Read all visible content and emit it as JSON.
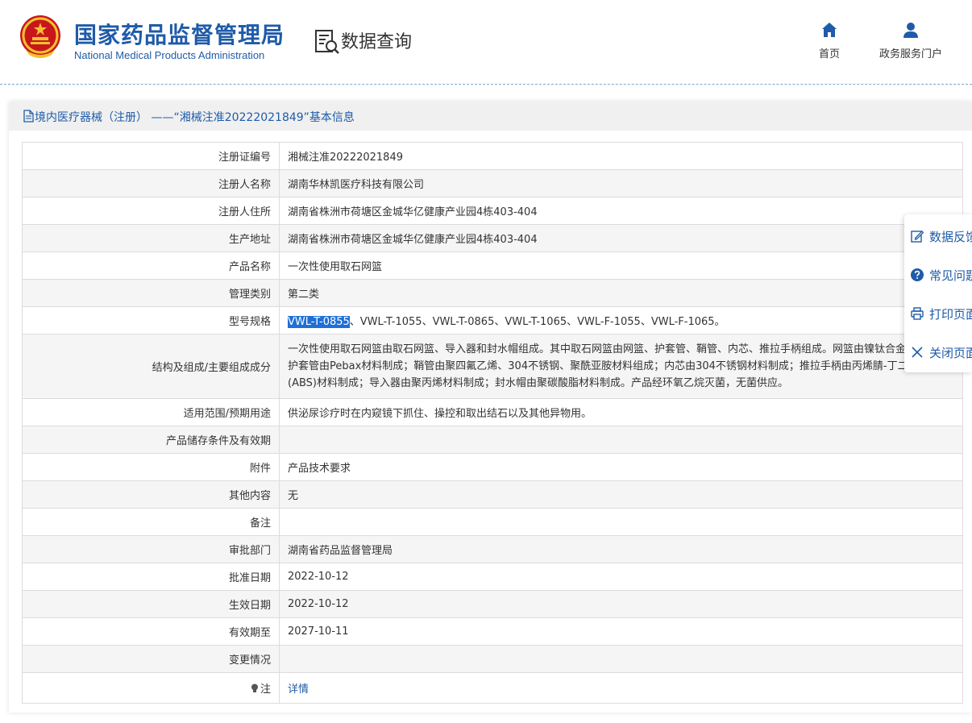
{
  "header": {
    "brand_cn": "国家药品监督管理局",
    "brand_en": "National Medical Products Administration",
    "section_title": "数据查询",
    "nav": [
      {
        "label": "首页",
        "icon": "home-icon"
      },
      {
        "label": "政务服务门户",
        "icon": "user-icon"
      }
    ]
  },
  "panel": {
    "title": "境内医疗器械（注册） ——“湘械注准20222021849”基本信息",
    "rows": [
      {
        "label": "注册证编号",
        "value": "湘械注准20222021849"
      },
      {
        "label": "注册人名称",
        "value": "湖南华林凯医疗科技有限公司"
      },
      {
        "label": "注册人住所",
        "value": "湖南省株洲市荷塘区金城华亿健康产业园4栋403-404"
      },
      {
        "label": "生产地址",
        "value": "湖南省株洲市荷塘区金城华亿健康产业园4栋403-404"
      },
      {
        "label": "产品名称",
        "value": "一次性使用取石网篮"
      },
      {
        "label": "管理类别",
        "value": "第二类"
      },
      {
        "label": "型号规格",
        "value_highlight": "VWL-T-0855",
        "value_rest": "、VWL-T-1055、VWL-T-0865、VWL-T-1065、VWL-F-1055、VWL-F-1065。"
      },
      {
        "label": "结构及组成/主要组成成分",
        "value": "一次性使用取石网篮由取石网篮、导入器和封水帽组成。其中取石网篮由网篮、护套管、鞘管、内芯、推拉手柄组成。网篮由镍钛合金材料制成；护套管由Pebax材料制成；鞘管由聚四氟乙烯、304不锈钢、聚酰亚胺材料组成；内芯由304不锈钢材料制成；推拉手柄由丙烯腈-丁二烯-苯乙烯(ABS)材料制成；导入器由聚丙烯材料制成；封水帽由聚碳酸脂材料制成。产品经环氧乙烷灭菌，无菌供应。"
      },
      {
        "label": "适用范围/预期用途",
        "value": "供泌尿诊疗时在内窥镜下抓住、操控和取出结石以及其他异物用。"
      },
      {
        "label": "产品储存条件及有效期",
        "value": ""
      },
      {
        "label": "附件",
        "value": "产品技术要求"
      },
      {
        "label": "其他内容",
        "value": "无"
      },
      {
        "label": "备注",
        "value": ""
      },
      {
        "label": "审批部门",
        "value": "湖南省药品监督管理局"
      },
      {
        "label": "批准日期",
        "value": "2022-10-12"
      },
      {
        "label": "生效日期",
        "value": "2022-10-12"
      },
      {
        "label": "有效期至",
        "value": "2027-10-11"
      },
      {
        "label": "变更情况",
        "value": ""
      },
      {
        "label": "注",
        "value": "详情"
      }
    ]
  },
  "float_bar": {
    "items": [
      {
        "label": "数据反馈",
        "icon": "edit-icon"
      },
      {
        "label": "常见问题",
        "icon": "question-icon"
      },
      {
        "label": "打印页面",
        "icon": "print-icon"
      },
      {
        "label": "关闭页面",
        "icon": "close-icon"
      }
    ]
  },
  "colors": {
    "brand_blue": "#1f5ba8",
    "highlight": "#1f6fd6",
    "row_alt": "#f5f5f5",
    "emblem_red": "#c8161d",
    "emblem_gold": "#f2c12e"
  }
}
